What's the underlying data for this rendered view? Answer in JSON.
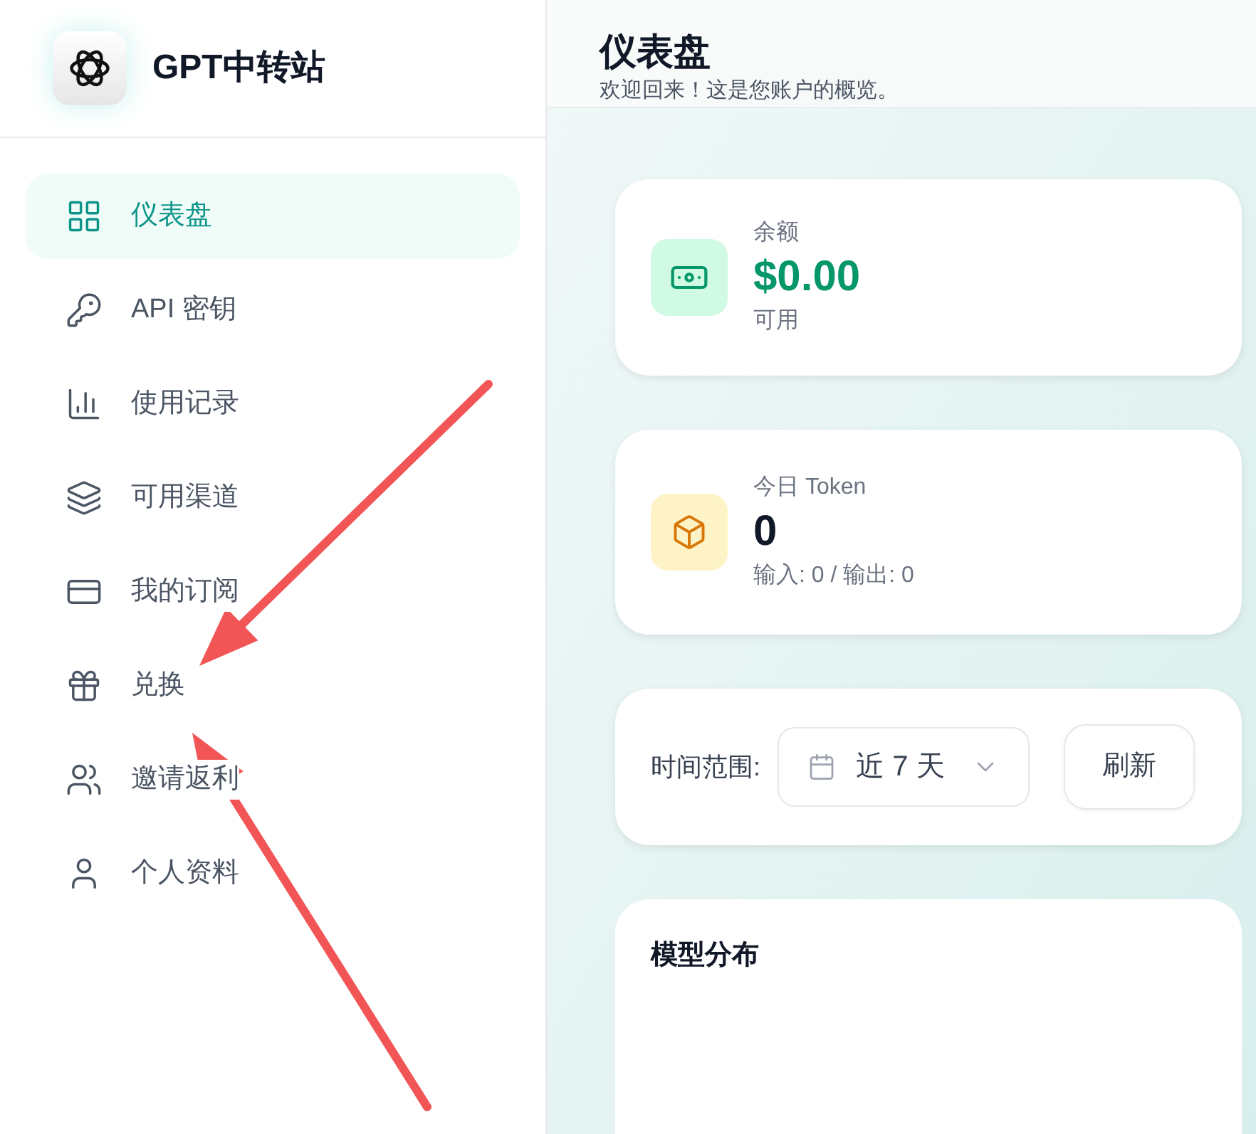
{
  "brand": {
    "name": "GPT中转站"
  },
  "sidebar": {
    "items": [
      {
        "kind": "grid",
        "label": "仪表盘",
        "selected": true
      },
      {
        "kind": "key",
        "label": "API 密钥",
        "selected": false
      },
      {
        "kind": "bars",
        "label": "使用记录",
        "selected": false
      },
      {
        "kind": "layers",
        "label": "可用渠道",
        "selected": false
      },
      {
        "kind": "card",
        "label": "我的订阅",
        "selected": false
      },
      {
        "kind": "gift",
        "label": "兑换",
        "selected": false
      },
      {
        "kind": "users",
        "label": "邀请返利",
        "selected": false
      },
      {
        "kind": "user",
        "label": "个人资料",
        "selected": false
      }
    ]
  },
  "header": {
    "title": "仪表盘",
    "subtitle": "欢迎回来！这是您账户的概览。"
  },
  "stats": [
    {
      "kind": "money",
      "label": "余额",
      "value": "$0.00",
      "note": "可用"
    },
    {
      "kind": "box",
      "label": "今日 Token",
      "value": "0",
      "note": "输入: 0 / 输出: 0"
    }
  ],
  "filter": {
    "label": "时间范围:",
    "range": "近 7 天",
    "refresh": "刷新"
  },
  "model_panel": {
    "title": "模型分布"
  },
  "annotations": [
    {
      "kind": "arrow"
    },
    {
      "kind": "arrow"
    }
  ]
}
